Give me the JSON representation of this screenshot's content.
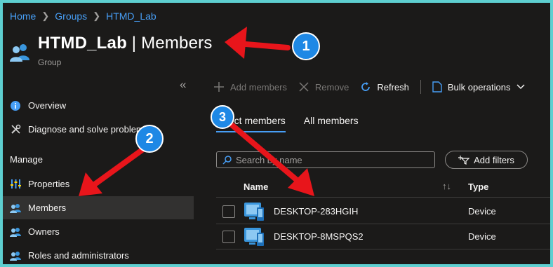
{
  "breadcrumb": [
    "Home",
    "Groups",
    "HTMD_Lab"
  ],
  "header": {
    "title_main": "HTMD_Lab",
    "title_sep": " | ",
    "title_page": "Members",
    "subtitle": "Group"
  },
  "sidebar": {
    "collapse_glyph": "«",
    "items_top": [
      {
        "label": "Overview",
        "icon": "info-icon"
      },
      {
        "label": "Diagnose and solve problems",
        "icon": "wrench-icon"
      }
    ],
    "section_label": "Manage",
    "items_manage": [
      {
        "label": "Properties",
        "icon": "properties-icon"
      },
      {
        "label": "Members",
        "icon": "people-icon",
        "active": true
      },
      {
        "label": "Owners",
        "icon": "people-icon"
      },
      {
        "label": "Roles and administrators",
        "icon": "people-icon"
      }
    ]
  },
  "toolbar": {
    "add": "Add members",
    "remove": "Remove",
    "refresh": "Refresh",
    "bulk": "Bulk operations"
  },
  "tabs": [
    "Direct members",
    "All members"
  ],
  "search": {
    "placeholder": "Search by name"
  },
  "filters_label": "Add filters",
  "table": {
    "columns": [
      "Name",
      "Type"
    ],
    "rows": [
      {
        "name": "DESKTOP-283HGIH",
        "type": "Device"
      },
      {
        "name": "DESKTOP-8MSPQS2",
        "type": "Device"
      }
    ]
  },
  "annotations": [
    "1",
    "2",
    "3"
  ],
  "colors": {
    "accent": "#479ef5",
    "arrow": "#e8151b",
    "badge": "#1e88e5",
    "frame_border": "#5ecfd0",
    "background": "#1b1a19"
  }
}
